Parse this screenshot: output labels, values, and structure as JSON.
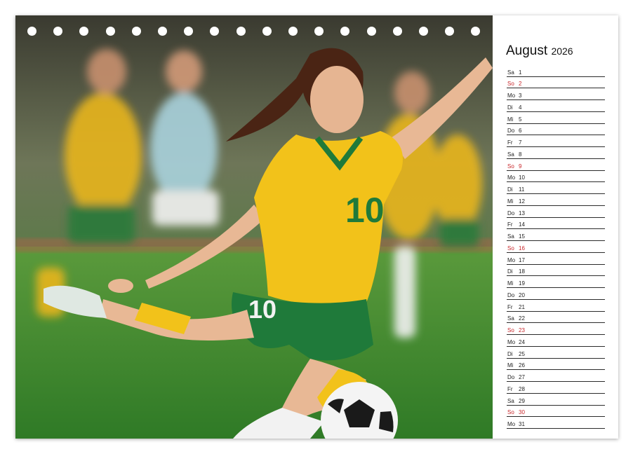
{
  "calendar": {
    "month": "August",
    "year": "2026",
    "days": [
      {
        "wd": "Sa",
        "d": "1"
      },
      {
        "wd": "So",
        "d": "2",
        "sun": true
      },
      {
        "wd": "Mo",
        "d": "3"
      },
      {
        "wd": "Di",
        "d": "4"
      },
      {
        "wd": "Mi",
        "d": "5"
      },
      {
        "wd": "Do",
        "d": "6"
      },
      {
        "wd": "Fr",
        "d": "7"
      },
      {
        "wd": "Sa",
        "d": "8"
      },
      {
        "wd": "So",
        "d": "9",
        "sun": true
      },
      {
        "wd": "Mo",
        "d": "10"
      },
      {
        "wd": "Di",
        "d": "11"
      },
      {
        "wd": "Mi",
        "d": "12"
      },
      {
        "wd": "Do",
        "d": "13"
      },
      {
        "wd": "Fr",
        "d": "14"
      },
      {
        "wd": "Sa",
        "d": "15"
      },
      {
        "wd": "So",
        "d": "16",
        "sun": true
      },
      {
        "wd": "Mo",
        "d": "17"
      },
      {
        "wd": "Di",
        "d": "18"
      },
      {
        "wd": "Mi",
        "d": "19"
      },
      {
        "wd": "Do",
        "d": "20"
      },
      {
        "wd": "Fr",
        "d": "21"
      },
      {
        "wd": "Sa",
        "d": "22"
      },
      {
        "wd": "So",
        "d": "23",
        "sun": true
      },
      {
        "wd": "Mo",
        "d": "24"
      },
      {
        "wd": "Di",
        "d": "25"
      },
      {
        "wd": "Mi",
        "d": "26"
      },
      {
        "wd": "Do",
        "d": "27"
      },
      {
        "wd": "Fr",
        "d": "28"
      },
      {
        "wd": "Sa",
        "d": "29"
      },
      {
        "wd": "So",
        "d": "30",
        "sun": true
      },
      {
        "wd": "Mo",
        "d": "31"
      }
    ]
  },
  "photo": {
    "jersey_number": "10",
    "shorts_number": "10"
  },
  "colors": {
    "sunday": "#c8262a",
    "jersey": "#f2c21a",
    "shorts": "#1f7a3a",
    "grass": "#3f8a2f"
  }
}
